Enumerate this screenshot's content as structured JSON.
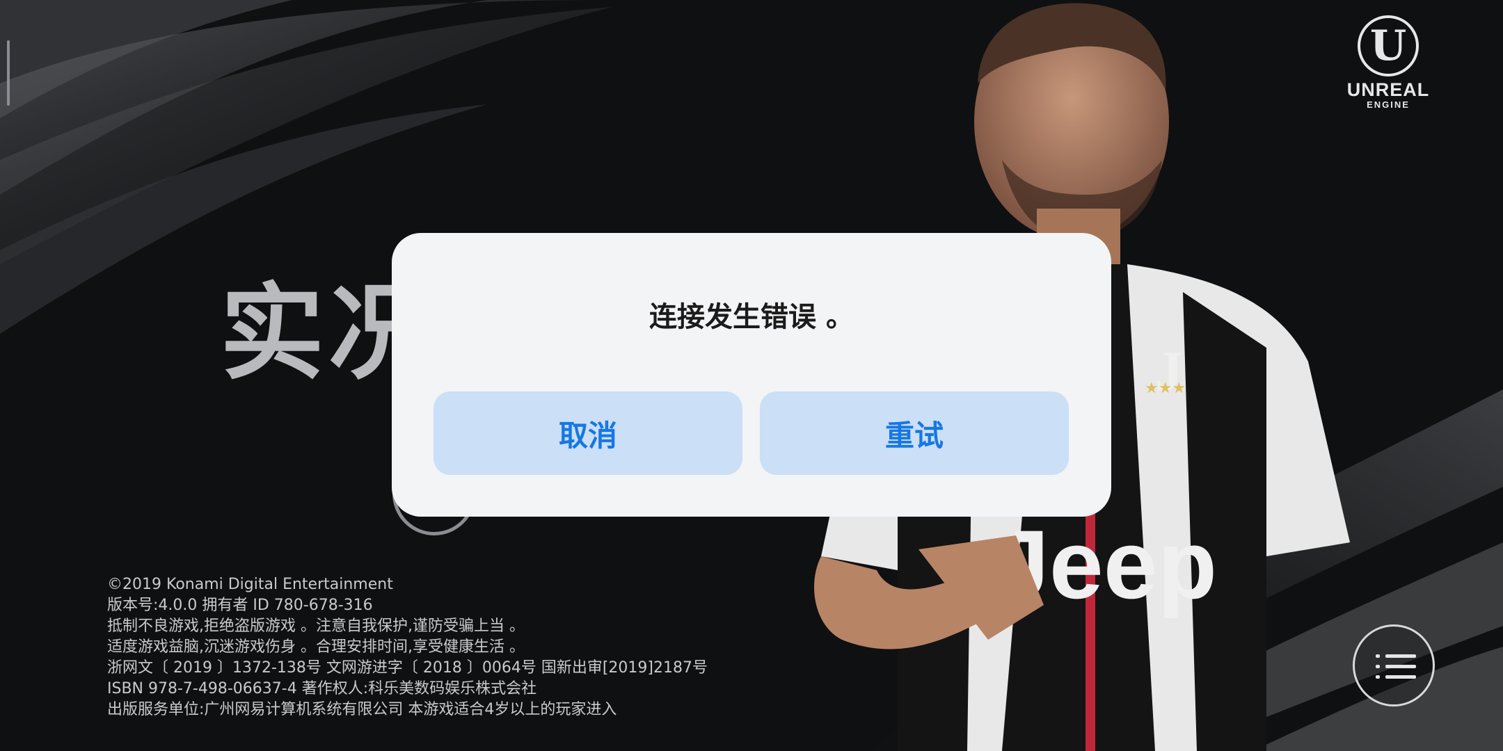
{
  "background": {
    "title_partial": "实况"
  },
  "engine_logo": {
    "line1": "UNREAL",
    "line2": "ENGINE",
    "icon": "unreal-engine-logo"
  },
  "dialog": {
    "message": "连接发生错误 。",
    "cancel_label": "取消",
    "retry_label": "重试"
  },
  "legal": {
    "lines": [
      "©2019 Konami Digital Entertainment",
      "版本号:4.0.0    拥有者 ID 780-678-316",
      "抵制不良游戏,拒绝盗版游戏 。注意自我保护,谨防受骗上当 。",
      "适度游戏益脑,沉迷游戏伤身 。合理安排时间,享受健康生活 。",
      "浙网文〔 2019 〕1372-138号 文网游进字〔 2018 〕0064号 国新出审[2019]2187号",
      "ISBN 978-7-498-06637-4 著作权人:科乐美数码娱乐株式会社",
      "出版服务单位:广州网易计算机系统有限公司 本游戏适合4岁以上的玩家进入"
    ]
  },
  "menu_icon": "menu-list-icon",
  "colors": {
    "accent": "#1677e5",
    "button_bg": "#cbdff6",
    "dialog_bg": "#f3f4f6"
  }
}
